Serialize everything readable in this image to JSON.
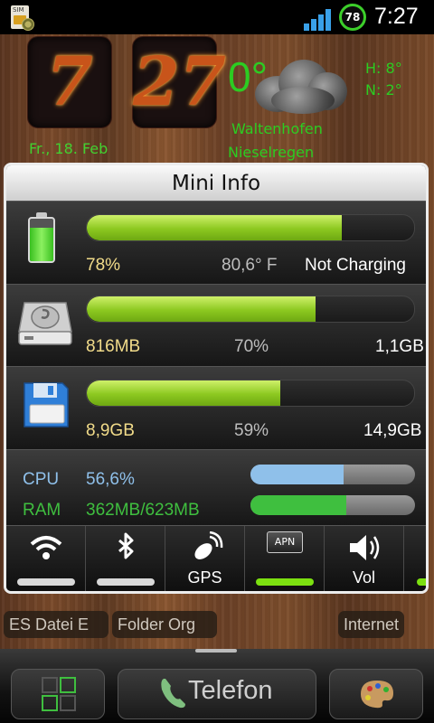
{
  "status_bar": {
    "sim_label": "SIM",
    "battery_level": "78",
    "time": "7:27"
  },
  "clock_widget": {
    "hour": "7",
    "minute": "27",
    "date": "Fr., 18. Feb"
  },
  "weather_widget": {
    "temperature": "0°",
    "high": "H:  8°",
    "low": "N:  2°",
    "location": "Waltenhofen",
    "condition": "Nieselregen"
  },
  "mini_info": {
    "title": "Mini Info",
    "battery": {
      "percent": "78%",
      "temperature": "80,6° F",
      "status": "Not Charging",
      "level": 0.78
    },
    "internal_storage": {
      "free": "816MB",
      "used_percent": "70%",
      "total": "1,1GB",
      "level": 0.7
    },
    "sd_card": {
      "free": "8,9GB",
      "used_percent": "59%",
      "total": "14,9GB",
      "level": 0.59
    },
    "cpu": {
      "label": "CPU",
      "value": "56,6%",
      "level": 0.566,
      "color": "#8fc0ea"
    },
    "ram": {
      "label": "RAM",
      "value": "362MB/623MB",
      "level": 0.581,
      "color": "#3fbf3f"
    }
  },
  "toggles": [
    {
      "name": "wifi",
      "label": "",
      "icon": "wifi-icon",
      "on": false
    },
    {
      "name": "bluetooth",
      "label": "",
      "icon": "bluetooth-icon",
      "on": false
    },
    {
      "name": "gps",
      "label": "GPS",
      "icon": "satellite-icon",
      "on": false
    },
    {
      "name": "apn",
      "label": "",
      "icon_text": "APN",
      "on": true
    },
    {
      "name": "volume",
      "label": "Vol",
      "icon": "speaker-icon",
      "on": false
    }
  ],
  "shortcuts": {
    "es_datei": "ES Datei E",
    "folder": "Folder Org",
    "internet": "Internet"
  },
  "dock": {
    "telefon": "Telefon"
  }
}
